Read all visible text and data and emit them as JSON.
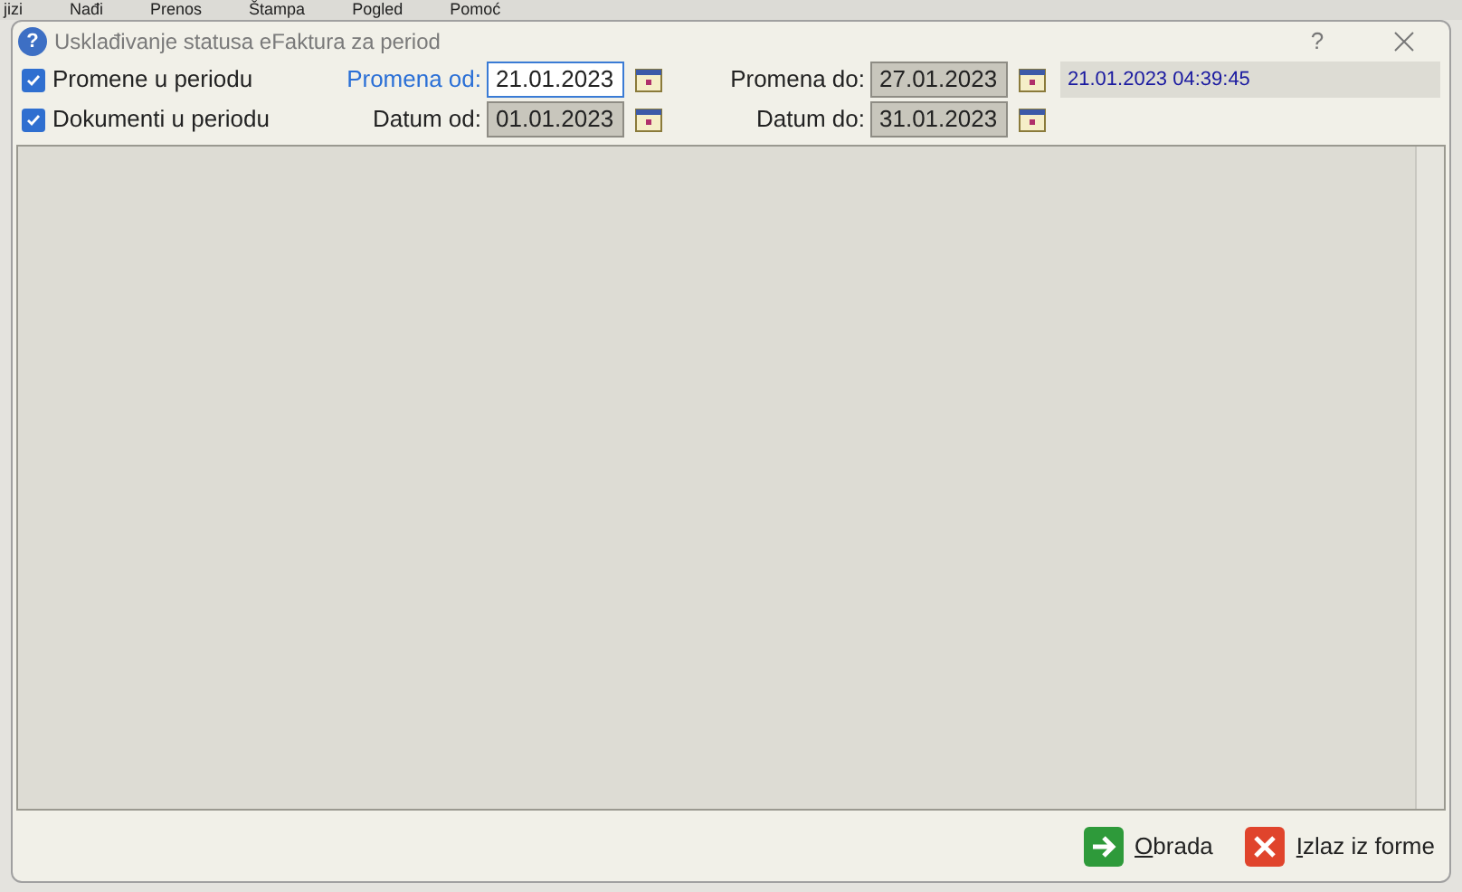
{
  "background_menu": [
    "jizi",
    "Nađi",
    "Prenos",
    "Štampa",
    "Pogled",
    "Pomoć"
  ],
  "window": {
    "icon": "?",
    "title": "Usklađivanje statusa eFaktura za period",
    "help": "?"
  },
  "rows": [
    {
      "checkbox": {
        "label": "Promene u periodu",
        "checked": true
      },
      "from": {
        "label": "Promena od:",
        "value": "21.01.2023",
        "focused": true
      },
      "to": {
        "label": "Promena do:",
        "value": "27.01.2023",
        "focused": false
      },
      "info": "21.01.2023 04:39:45"
    },
    {
      "checkbox": {
        "label": "Dokumenti u periodu",
        "checked": true
      },
      "from": {
        "label": "Datum od:",
        "value": "01.01.2023",
        "focused": false
      },
      "to": {
        "label": "Datum do:",
        "value": "31.01.2023",
        "focused": false
      }
    }
  ],
  "buttons": [
    {
      "kind": "run",
      "label": "Obrada"
    },
    {
      "kind": "exit",
      "label": "Izlaz iz forme"
    }
  ]
}
